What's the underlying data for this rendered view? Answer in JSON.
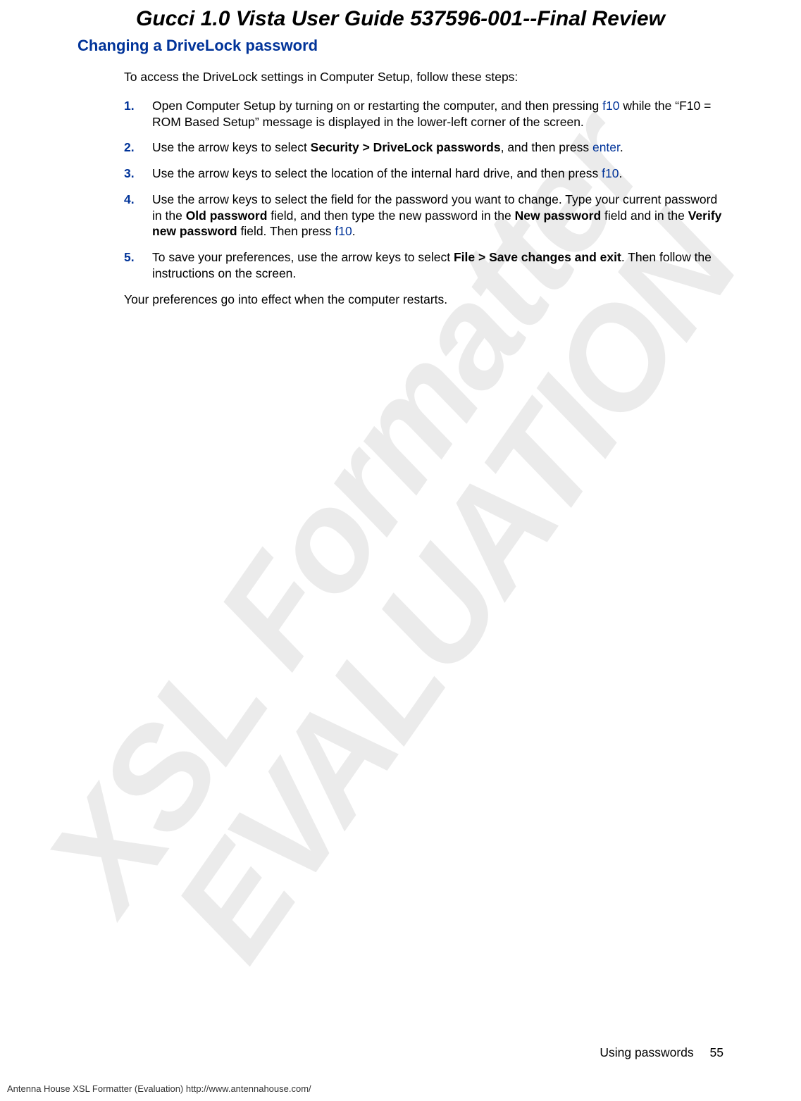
{
  "watermark": {
    "line1": "XSL Formatter",
    "line2": "EVALUATION"
  },
  "doc_title": "Gucci 1.0 Vista User Guide 537596-001--Final Review",
  "section_heading": "Changing a DriveLock password",
  "intro": "To access the DriveLock settings in Computer Setup, follow these steps:",
  "steps": [
    {
      "num": "1.",
      "parts": [
        {
          "t": "Open Computer Setup by turning on or restarting the computer, and then pressing "
        },
        {
          "t": "f10",
          "cls": "link-blue"
        },
        {
          "t": " while the “F10 = ROM Based Setup” message is displayed in the lower-left corner of the screen."
        }
      ]
    },
    {
      "num": "2.",
      "parts": [
        {
          "t": "Use the arrow keys to select "
        },
        {
          "t": "Security > DriveLock passwords",
          "cls": "bold"
        },
        {
          "t": ", and then press "
        },
        {
          "t": "enter",
          "cls": "link-blue"
        },
        {
          "t": "."
        }
      ]
    },
    {
      "num": "3.",
      "parts": [
        {
          "t": "Use the arrow keys to select the location of the internal hard drive, and then press "
        },
        {
          "t": "f10",
          "cls": "link-blue"
        },
        {
          "t": "."
        }
      ]
    },
    {
      "num": "4.",
      "parts": [
        {
          "t": "Use the arrow keys to select the field for the password you want to change. Type your current password in the "
        },
        {
          "t": "Old password",
          "cls": "bold"
        },
        {
          "t": " field, and then type the new password in the "
        },
        {
          "t": "New password",
          "cls": "bold"
        },
        {
          "t": " field and in the "
        },
        {
          "t": "Verify new password",
          "cls": "bold"
        },
        {
          "t": " field. Then press "
        },
        {
          "t": "f10",
          "cls": "link-blue"
        },
        {
          "t": "."
        }
      ]
    },
    {
      "num": "5.",
      "parts": [
        {
          "t": "To save your preferences, use the arrow keys to select "
        },
        {
          "t": "File > Save changes and exit",
          "cls": "bold"
        },
        {
          "t": ". Then follow the instructions on the screen."
        }
      ]
    }
  ],
  "closing": "Your preferences go into effect when the computer restarts.",
  "footer": {
    "section": "Using passwords",
    "page": "55",
    "eval": "Antenna House XSL Formatter (Evaluation)  http://www.antennahouse.com/"
  }
}
